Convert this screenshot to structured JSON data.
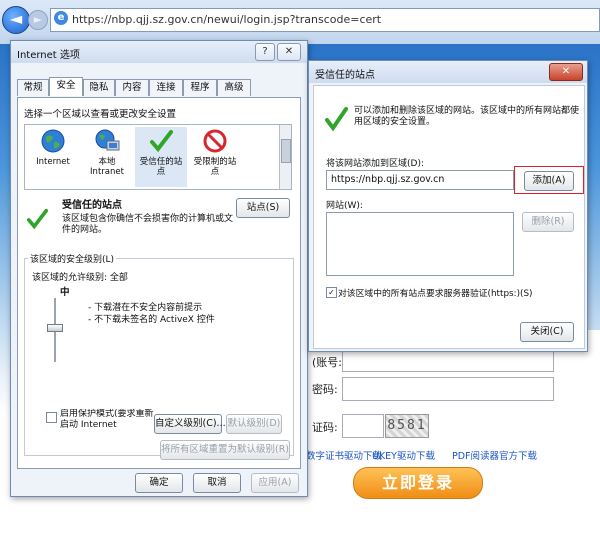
{
  "browser": {
    "back_glyph": "◄",
    "forward_glyph": "►",
    "url": "https://nbp.qjj.sz.gov.cn/newui/login.jsp?transcode=cert"
  },
  "site": {
    "field_labels": [
      "(账号:",
      "密码:",
      "证码:"
    ],
    "captcha": "8581",
    "links": [
      "数字证书驱动下载",
      "UKEY驱动下载",
      "PDF阅读器官方下载"
    ],
    "login_button": "立即登录"
  },
  "internet_options": {
    "title": "Internet 选项",
    "help_button": "?",
    "close_button": "✕",
    "tabs": [
      "常规",
      "安全",
      "隐私",
      "内容",
      "连接",
      "程序",
      "高级"
    ],
    "zone_prompt": "选择一个区域以查看或更改安全设置",
    "zones": [
      {
        "label": "Internet",
        "icon": "globe-icon"
      },
      {
        "label": "本地\nIntranet",
        "icon": "intranet-icon"
      },
      {
        "label": "受信任的站\n点",
        "icon": "checkmark-icon"
      },
      {
        "label": "受限制的站\n点",
        "icon": "restricted-icon"
      }
    ],
    "zone_title": "受信任的站点",
    "zone_description": "该区域包含你确信不会损害你的计算机或文\n件的网站。",
    "sites_button": "站点(S)",
    "security_level_group": "该区域的安全级别(L)",
    "allowed_levels": "该区域的允许级别: 全部",
    "current_level": "中",
    "level_notes": [
      "- 下载潜在不安全内容前提示",
      "- 不下载未签名的 ActiveX 控件"
    ],
    "protected_mode_label": "启用保护模式(要求重新\n启动 Internet\n",
    "custom_level_button": "自定义级别(C)...",
    "default_level_button": "默认级别(D)",
    "reset_all_button": "将所有区域重置为默认级别(R)",
    "ok_button": "确定",
    "cancel_button": "取消",
    "apply_button": "应用(A)"
  },
  "trusted_sites": {
    "title": "受信任的站点",
    "close_button": "✕",
    "info": "可以添加和删除该区域的网站。该区域中的所有网站都使\n用区域的安全设置。",
    "add_label": "将该网站添加到区域(D):",
    "add_value": "https://nbp.qjj.sz.gov.cn",
    "add_button": "添加(A)",
    "websites_label": "网站(W):",
    "remove_button": "删除(R)",
    "https_check_mark": "✓",
    "https_label": "对该区域中的所有站点要求服务器验证(https:)(S)",
    "close_dialog_button": "关闭(C)"
  },
  "colors": {
    "accent_red": "#e0212b",
    "check_green": "#2fa52a",
    "link_blue": "#1b55c2"
  }
}
